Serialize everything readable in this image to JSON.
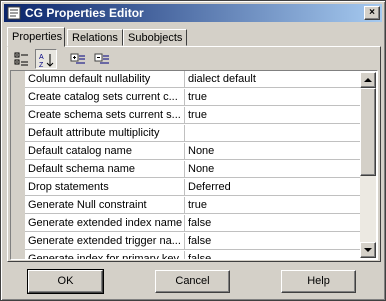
{
  "window": {
    "title": "CG Properties Editor",
    "close_glyph": "×"
  },
  "tabs": [
    {
      "label": "Properties",
      "active": true
    },
    {
      "label": "Relations",
      "active": false
    },
    {
      "label": "Subobjects",
      "active": false
    }
  ],
  "toolbar": {
    "buttons": [
      {
        "icon": "categorized-view-icon",
        "pressed": false
      },
      {
        "icon": "sort-alphabetical-icon",
        "pressed": true
      },
      {
        "icon": "expand-all-icon",
        "pressed": false
      },
      {
        "icon": "collapse-all-icon",
        "pressed": false
      }
    ]
  },
  "properties": [
    {
      "name": "Column default nullability",
      "value": "dialect default"
    },
    {
      "name": "Create catalog sets current c...",
      "value": "true"
    },
    {
      "name": "Create schema sets current s...",
      "value": "true"
    },
    {
      "name": "Default attribute multiplicity",
      "value": ""
    },
    {
      "name": "Default catalog name",
      "value": "None"
    },
    {
      "name": "Default schema name",
      "value": "None"
    },
    {
      "name": "Drop statements",
      "value": "Deferred"
    },
    {
      "name": "Generate Null constraint",
      "value": "true"
    },
    {
      "name": "Generate extended index name",
      "value": "false"
    },
    {
      "name": "Generate extended trigger na...",
      "value": "false"
    },
    {
      "name": "Generate index for primary key",
      "value": "false"
    }
  ],
  "buttons": {
    "ok": "OK",
    "cancel": "Cancel",
    "help": "Help"
  }
}
